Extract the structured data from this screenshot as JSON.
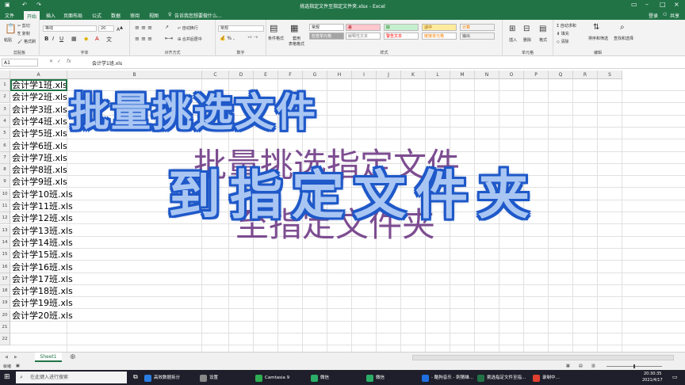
{
  "window": {
    "title": "挑选指定文件至指定文件夹.xlsx - Excel",
    "login": "登录"
  },
  "ribbon_tabs": [
    "文件",
    "开始",
    "插入",
    "页面布局",
    "公式",
    "数据",
    "审阅",
    "视图"
  ],
  "tell_me": "告诉我您想要做什么...",
  "share": "共享",
  "ribbon": {
    "clipboard": {
      "label": "剪贴板",
      "paste": "粘贴",
      "cut": "剪切",
      "copy": "复制",
      "format_painter": "格式刷"
    },
    "font": {
      "label": "字体",
      "name": "等线",
      "size": "20"
    },
    "alignment": {
      "label": "对齐方式",
      "wrap": "自动换行",
      "merge": "合并后居中"
    },
    "number": {
      "label": "数字",
      "format": "常规"
    },
    "styles": {
      "label": "样式",
      "conditional": "条件格式",
      "table": "套用\n表格格式",
      "cells": [
        {
          "text": "常规",
          "bg": "#ffffff",
          "fg": "#222222"
        },
        {
          "text": "差",
          "bg": "#ffc7ce",
          "fg": "#9c0006"
        },
        {
          "text": "好",
          "bg": "#c6efce",
          "fg": "#006100"
        },
        {
          "text": "适中",
          "bg": "#ffeb9c",
          "fg": "#9c5700"
        },
        {
          "text": "计算",
          "bg": "#f2f2f2",
          "fg": "#fa7d00"
        },
        {
          "text": "检查单元格",
          "bg": "#a5a5a5",
          "fg": "#ffffff"
        },
        {
          "text": "解释性文本",
          "bg": "#ffffff",
          "fg": "#7f7f7f"
        },
        {
          "text": "警告文本",
          "bg": "#ffffff",
          "fg": "#ff0000"
        },
        {
          "text": "链接单元格",
          "bg": "#ffffff",
          "fg": "#fa7d00"
        },
        {
          "text": "输出",
          "bg": "#f2f2f2",
          "fg": "#3f3f3f"
        }
      ]
    },
    "cells_group": {
      "label": "单元格",
      "insert": "插入",
      "delete": "删除",
      "format": "格式"
    },
    "editing": {
      "label": "编辑",
      "autosum": "自动求和",
      "fill": "填充",
      "clear": "清除",
      "sort": "排序和筛选",
      "find": "查找和选择"
    }
  },
  "formula_bar": {
    "name_box": "A1",
    "fx": "fx",
    "value": "会计学1班.xls"
  },
  "columns": [
    "A",
    "B",
    "C",
    "D",
    "E",
    "F",
    "G",
    "H",
    "I",
    "J",
    "K",
    "L",
    "M",
    "N",
    "O",
    "P",
    "Q",
    "R",
    "S"
  ],
  "rows": [
    "1",
    "2",
    "3",
    "4",
    "5",
    "6",
    "7",
    "8",
    "9",
    "10",
    "11",
    "12",
    "13",
    "14",
    "15",
    "16",
    "17",
    "18",
    "19",
    "20",
    "21",
    "22"
  ],
  "cells": [
    "会计学1班.xls",
    "会计学2班.xls",
    "会计学3班.xls",
    "会计学4班.xls",
    "会计学5班.xls",
    "会计学6班.xls",
    "会计学7班.xls",
    "会计学8班.xls",
    "会计学9班.xls",
    "会计学10班.xls",
    "会计学11班.xls",
    "会计学12班.xls",
    "会计学13班.xls",
    "会计学14班.xls",
    "会计学15班.xls",
    "会计学16班.xls",
    "会计学17班.xls",
    "会计学18班.xls",
    "会计学19班.xls",
    "会计学20班.xls"
  ],
  "overlay": {
    "line1": "批量挑选文件",
    "line2": "到指定文件夹",
    "ghost1": "批量挑选指定文件",
    "ghost2": "至指定文件夹"
  },
  "sheet_tab": "Sheet1",
  "status": {
    "ready": "就绪"
  },
  "taskbar": {
    "search_placeholder": "在此键入进行搜索",
    "apps": [
      "高效数据拆分",
      "设置",
      "Camtasia 9",
      "微信",
      "微信",
      "- 酷狗音乐 - 刺猬雄…",
      "挑选指定文件至指…",
      "录制中…"
    ],
    "time": "20:30:35",
    "date": "2021/4/17"
  },
  "colors": {
    "excel_green": "#217346",
    "overlay_fill": "#a9c6f3",
    "overlay_stroke": "#1e58c9",
    "ghost_text": "#6f3a86"
  }
}
